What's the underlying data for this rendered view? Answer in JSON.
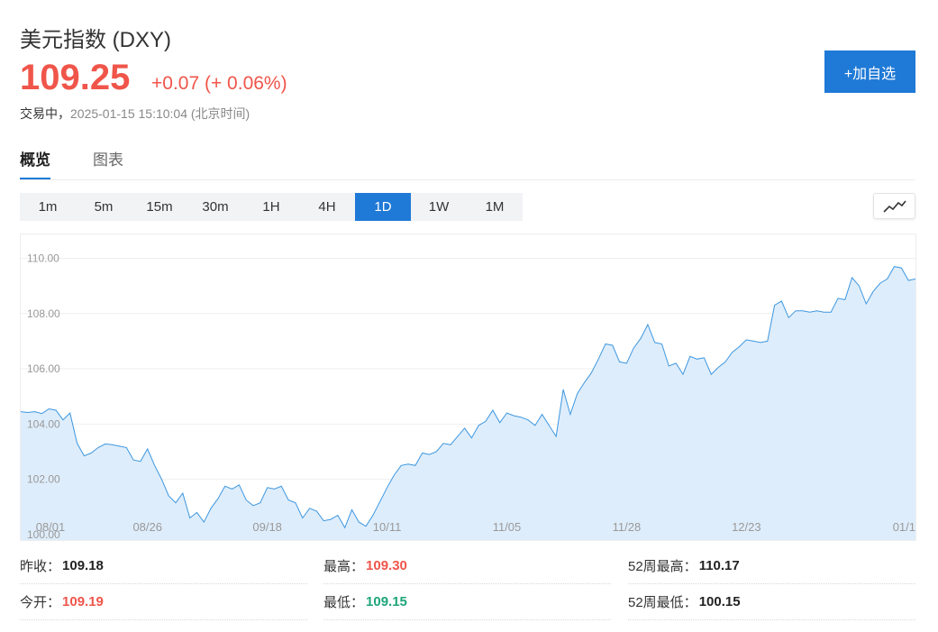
{
  "header": {
    "title": "美元指数 (DXY)",
    "price": "109.25",
    "change": "+0.07 (+ 0.06%)",
    "status_label": "交易中，",
    "timestamp": "2025-01-15 15:10:04 (北京时间)",
    "add_button": "+加自选"
  },
  "colors": {
    "up": "#f0554a",
    "down": "#1ea57a",
    "accent": "#1f79d6",
    "line": "#3d97e0",
    "area": "#deedfb"
  },
  "tabs": [
    {
      "label": "概览",
      "active": true
    },
    {
      "label": "图表",
      "active": false
    }
  ],
  "periods": [
    {
      "label": "1m",
      "active": false
    },
    {
      "label": "5m",
      "active": false
    },
    {
      "label": "15m",
      "active": false
    },
    {
      "label": "30m",
      "active": false
    },
    {
      "label": "1H",
      "active": false
    },
    {
      "label": "4H",
      "active": false
    },
    {
      "label": "1D",
      "active": true
    },
    {
      "label": "1W",
      "active": false
    },
    {
      "label": "1M",
      "active": false
    }
  ],
  "chart_toggle_icon": "line-chart-icon",
  "chart_data": {
    "type": "area",
    "ylim": [
      99.9,
      110.7
    ],
    "y_ticks": [
      "100.00",
      "102.00",
      "104.00",
      "106.00",
      "108.00",
      "110.00"
    ],
    "y_tick_values": [
      100,
      102,
      104,
      106,
      108,
      110
    ],
    "x_ticks": [
      "08/01",
      "08/26",
      "09/18",
      "10/11",
      "11/05",
      "11/28",
      "12/23",
      "01/1"
    ],
    "x_tick_index": [
      0,
      18,
      35,
      52,
      69,
      86,
      103,
      120
    ],
    "grid": true,
    "series": [
      {
        "values": [
          104.45,
          104.42,
          104.45,
          104.38,
          104.55,
          104.5,
          104.15,
          104.4,
          103.3,
          102.85,
          102.95,
          103.15,
          103.28,
          103.25,
          103.2,
          103.15,
          102.7,
          102.65,
          103.1,
          102.5,
          102.0,
          101.4,
          101.15,
          101.5,
          100.6,
          100.8,
          100.45,
          100.95,
          101.3,
          101.75,
          101.65,
          101.8,
          101.25,
          101.05,
          101.15,
          101.7,
          101.65,
          101.75,
          101.25,
          101.15,
          100.6,
          100.95,
          100.85,
          100.5,
          100.55,
          100.7,
          100.25,
          100.9,
          100.45,
          100.3,
          100.7,
          101.2,
          101.7,
          102.15,
          102.5,
          102.55,
          102.5,
          102.95,
          102.9,
          103.0,
          103.3,
          103.25,
          103.55,
          103.85,
          103.5,
          103.95,
          104.1,
          104.5,
          104.05,
          104.4,
          104.3,
          104.25,
          104.15,
          103.95,
          104.35,
          103.95,
          103.55,
          105.25,
          104.35,
          105.1,
          105.5,
          105.85,
          106.35,
          106.9,
          106.85,
          106.25,
          106.2,
          106.75,
          107.1,
          107.6,
          106.95,
          106.9,
          106.1,
          106.2,
          105.8,
          106.45,
          106.35,
          106.4,
          105.8,
          106.05,
          106.25,
          106.6,
          106.8,
          107.05,
          107.0,
          106.95,
          107.0,
          108.3,
          108.45,
          107.85,
          108.1,
          108.1,
          108.05,
          108.1,
          108.05,
          108.05,
          108.55,
          108.5,
          109.3,
          109.0,
          108.35,
          108.8,
          109.1,
          109.25,
          109.7,
          109.65,
          109.2,
          109.25
        ]
      }
    ]
  },
  "stats": {
    "prev_close_label": "昨收：",
    "prev_close": "109.18",
    "high_label": "最高：",
    "high": "109.30",
    "high52_label": "52周最高：",
    "high52": "110.17",
    "open_label": "今开：",
    "open": "109.19",
    "low_label": "最低：",
    "low": "109.15",
    "low52_label": "52周最低：",
    "low52": "100.15"
  }
}
